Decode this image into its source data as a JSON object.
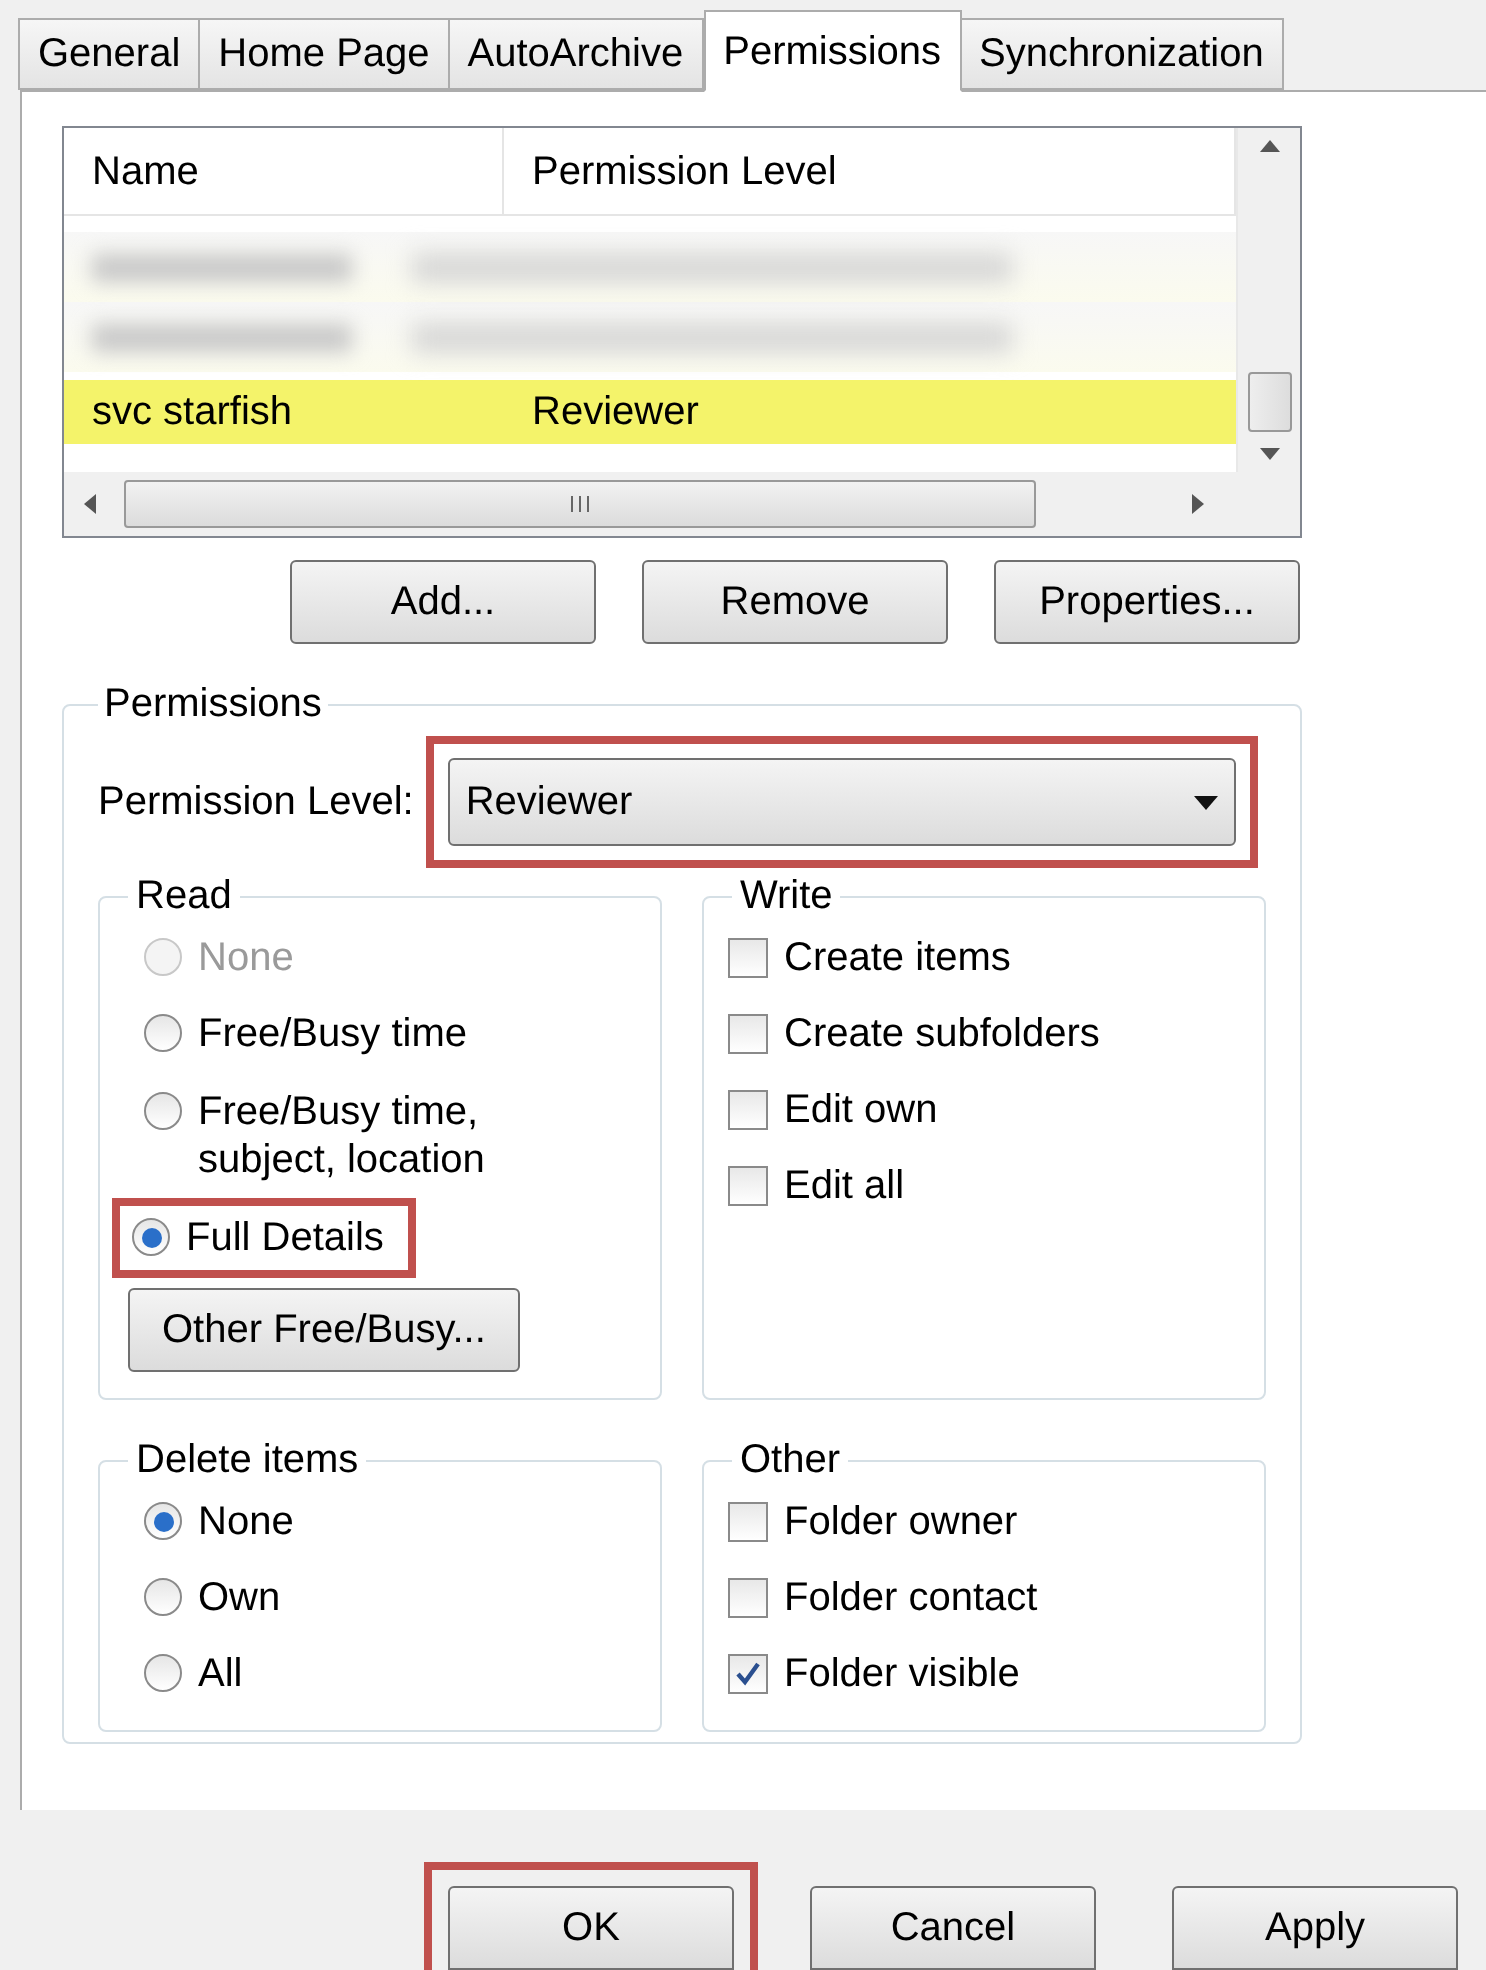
{
  "tabs": [
    {
      "label": "General",
      "selected": false
    },
    {
      "label": "Home Page",
      "selected": false
    },
    {
      "label": "AutoArchive",
      "selected": false
    },
    {
      "label": "Permissions",
      "selected": true
    },
    {
      "label": "Synchronization",
      "selected": false
    }
  ],
  "permissions_list": {
    "columns": [
      "Name",
      "Permission Level"
    ],
    "rows": [
      {
        "kind": "redacted",
        "selected": false
      },
      {
        "kind": "redacted",
        "selected": false
      },
      {
        "kind": "entry",
        "name": "svc starfish",
        "level_text": "Reviewer",
        "selected": true
      }
    ]
  },
  "list_buttons": [
    "Add...",
    "Remove",
    "Properties..."
  ],
  "permissions": {
    "title": "Permissions",
    "level_label": "Permission Level:",
    "level_value": "Reviewer",
    "highlighted": true,
    "read": {
      "title": "Read",
      "options": [
        {
          "label": "None",
          "selected": false,
          "disabled": true,
          "highlighted": false
        },
        {
          "label": "Free/Busy time",
          "selected": false,
          "disabled": false,
          "highlighted": false
        },
        {
          "label": "Free/Busy time,\nsubject, location",
          "selected": false,
          "disabled": false,
          "highlighted": false
        },
        {
          "label": "Full Details",
          "selected": true,
          "disabled": false,
          "highlighted": true
        }
      ],
      "button": "Other Free/Busy..."
    },
    "write": {
      "title": "Write",
      "items": [
        {
          "label": "Create items",
          "checked": false
        },
        {
          "label": "Create subfolders",
          "checked": false
        },
        {
          "label": "Edit own",
          "checked": false
        },
        {
          "label": "Edit all",
          "checked": false
        }
      ]
    },
    "delete": {
      "title": "Delete items",
      "options": [
        {
          "label": "None",
          "selected": true,
          "disabled": false,
          "highlighted": false
        },
        {
          "label": "Own",
          "selected": false,
          "disabled": false,
          "highlighted": false
        },
        {
          "label": "All",
          "selected": false,
          "disabled": false,
          "highlighted": false
        }
      ]
    },
    "other": {
      "title": "Other",
      "items": [
        {
          "label": "Folder owner",
          "checked": false
        },
        {
          "label": "Folder contact",
          "checked": false
        },
        {
          "label": "Folder visible",
          "checked": true
        }
      ]
    }
  },
  "dialog_buttons": [
    {
      "label": "OK",
      "highlighted": true
    },
    {
      "label": "Cancel",
      "highlighted": false
    },
    {
      "label": "Apply",
      "highlighted": false
    }
  ]
}
